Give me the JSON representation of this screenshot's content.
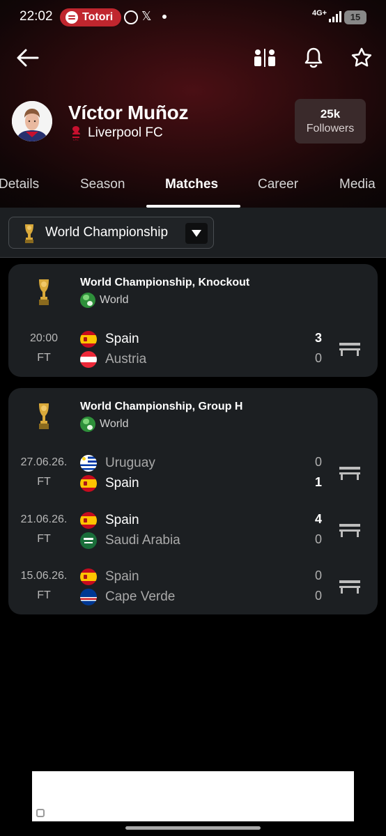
{
  "status_bar": {
    "time": "22:02",
    "spotify_label": "Totori",
    "x_icon": "𝕏",
    "network": "4G+",
    "battery": "15"
  },
  "toolbar": {
    "icons": [
      "back-arrow-icon",
      "compare-icon",
      "bell-icon",
      "star-icon"
    ]
  },
  "profile": {
    "name": "Víctor Muñoz",
    "club": "Liverpool FC",
    "followers_count": "25k",
    "followers_label": "Followers"
  },
  "tabs": [
    "Details",
    "Season",
    "Matches",
    "Career",
    "Media"
  ],
  "active_tab": "Matches",
  "filter": {
    "selected": "World Championship"
  },
  "competitions": [
    {
      "title": "World Championship, Knockout",
      "region": "World",
      "matches": [
        {
          "date": "20:00",
          "status": "FT",
          "home": {
            "name": "Spain",
            "score": "3"
          },
          "away": {
            "name": "Austria",
            "score": "0"
          }
        }
      ]
    },
    {
      "title": "World Championship, Group H",
      "region": "World",
      "matches": [
        {
          "date": "27.06.26.",
          "status": "FT",
          "home": {
            "name": "Uruguay",
            "score": "0"
          },
          "away": {
            "name": "Spain",
            "score": "1"
          }
        },
        {
          "date": "21.06.26.",
          "status": "FT",
          "home": {
            "name": "Spain",
            "score": "4"
          },
          "away": {
            "name": "Saudi Arabia",
            "score": "0"
          }
        },
        {
          "date": "15.06.26.",
          "status": "FT",
          "home": {
            "name": "Spain",
            "score": "0"
          },
          "away": {
            "name": "Cape Verde",
            "score": "0"
          }
        }
      ]
    }
  ],
  "colors": {
    "background": "#000000",
    "card": "#1c1f22",
    "header_accent": "#4a0f14",
    "spotify_pill": "#c0262e"
  }
}
